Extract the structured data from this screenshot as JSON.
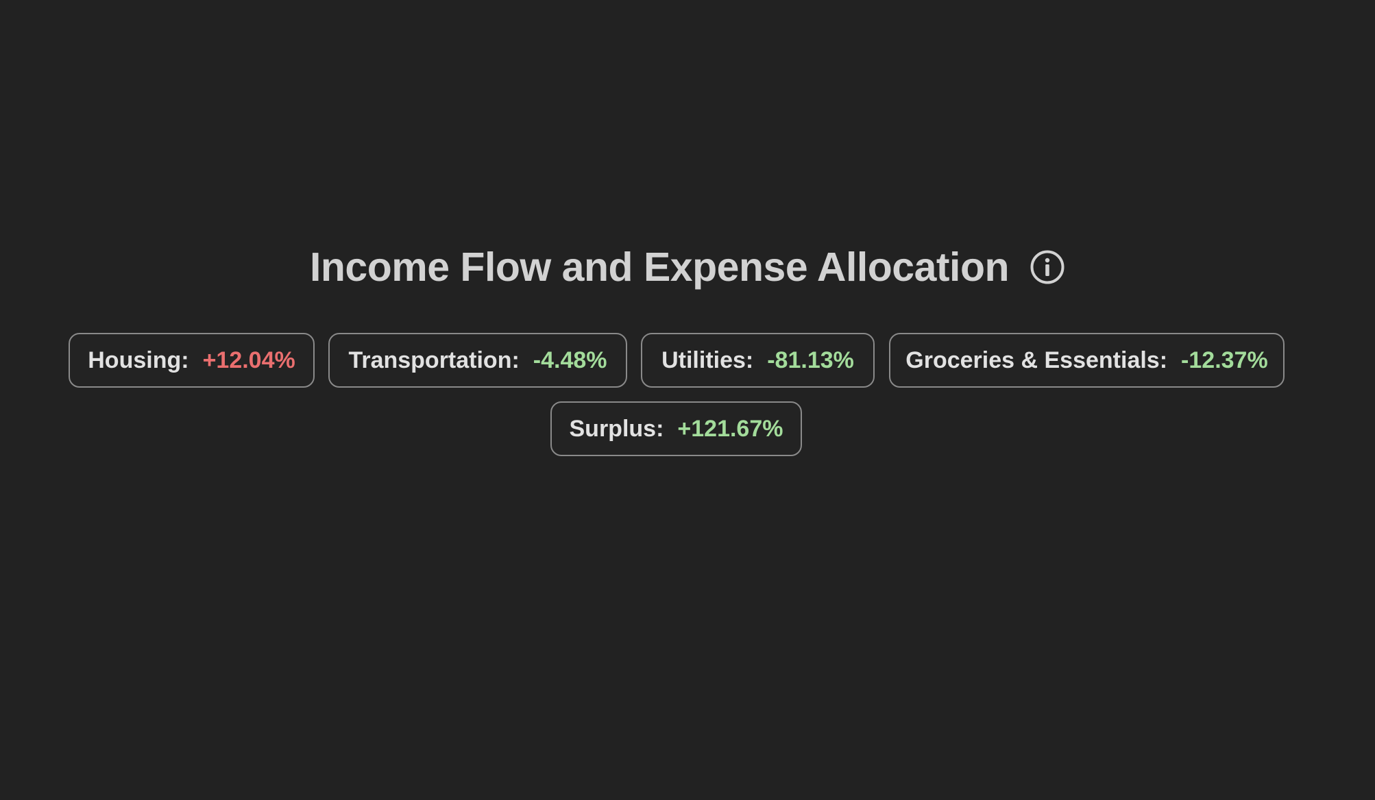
{
  "header": {
    "title": "Income Flow and Expense Allocation",
    "info_icon": "info-circle-icon"
  },
  "categories": [
    {
      "label": "Housing:",
      "change": "+12.04%",
      "direction": "increase",
      "color": "#ea6f6f"
    },
    {
      "label": "Transportation:",
      "change": "-4.48%",
      "direction": "decrease",
      "color": "#a3dc9b"
    },
    {
      "label": "Utilities:",
      "change": "-81.13%",
      "direction": "decrease",
      "color": "#a3dc9b"
    },
    {
      "label": "Groceries & Essentials:",
      "change": "-12.37%",
      "direction": "decrease",
      "color": "#a3dc9b"
    },
    {
      "label": "Surplus:",
      "change": "+121.67%",
      "direction": "increase",
      "color": "#a3dc9b"
    }
  ],
  "colors": {
    "background": "#222222",
    "title": "#d2d2d2",
    "chip_border": "#8a8a8a",
    "negative_change": "#ea6f6f",
    "positive_change": "#a3dc9b"
  }
}
